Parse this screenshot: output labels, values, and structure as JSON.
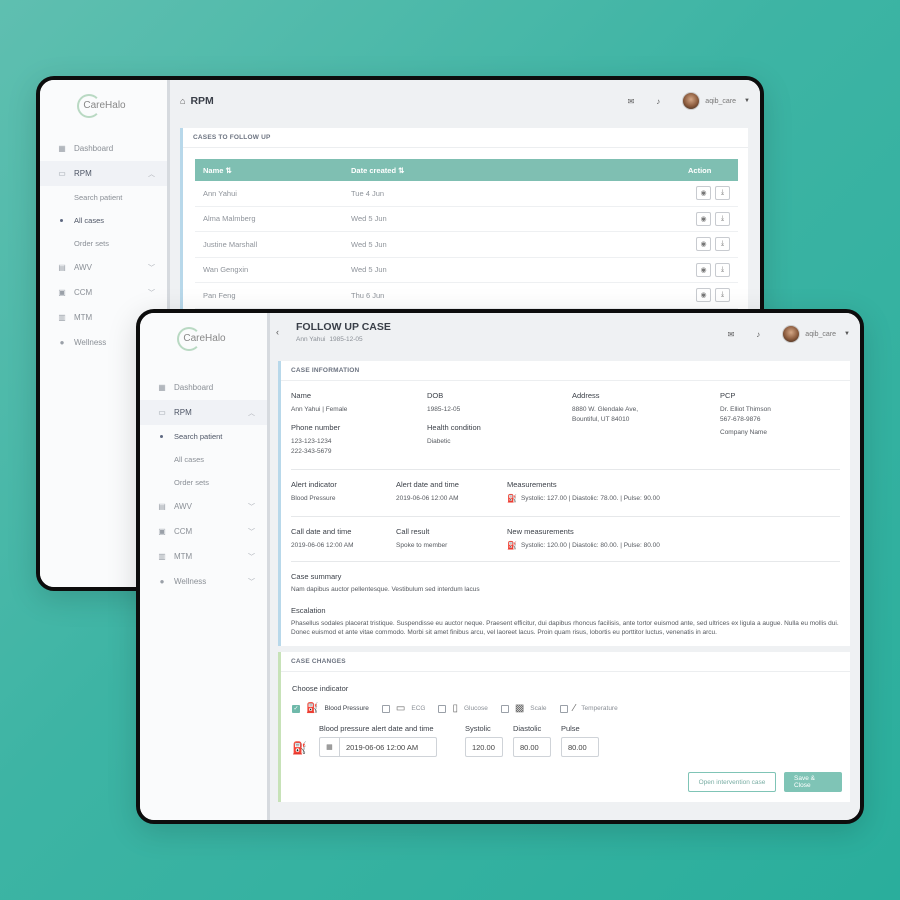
{
  "brand": {
    "logo_text": "CareHalo"
  },
  "user": {
    "name": "aqib_care"
  },
  "sidebar": {
    "dashboard": "Dashboard",
    "rpm": "RPM",
    "rpm_sub": [
      "Search patient",
      "All cases",
      "Order sets"
    ],
    "awv": "AWV",
    "ccm": "CCM",
    "mtm": "MTM",
    "wellness": "Wellness"
  },
  "back_screen": {
    "page_title": "RPM",
    "card_title": "CASES TO FOLLOW UP",
    "columns": {
      "name": "Name",
      "date": "Date created",
      "action": "Action"
    },
    "rows": [
      {
        "name": "Ann Yahui",
        "date": "Tue 4 Jun"
      },
      {
        "name": "Alma Malmberg",
        "date": "Wed 5 Jun"
      },
      {
        "name": "Justine Marshall",
        "date": "Wed 5 Jun"
      },
      {
        "name": "Wan Gengxin",
        "date": "Wed 5 Jun"
      },
      {
        "name": "Pan Feng",
        "date": "Thu 6 Jun"
      }
    ]
  },
  "front_screen": {
    "page_title": "FOLLOW UP CASE",
    "subtitle_name": "Ann Yahui",
    "subtitle_dob": "1985-12-05",
    "case_info": {
      "title": "CASE INFORMATION",
      "name_label": "Name",
      "name_value": "Ann Yahui | Female",
      "dob_label": "DOB",
      "dob_value": "1985-12-05",
      "address_label": "Address",
      "address_line1": "8880 W. Glendale Ave,",
      "address_line2": "Bountiful, UT 84010",
      "pcp_label": "PCP",
      "pcp_name": "Dr. Elliot Thimson",
      "pcp_phone": "567-678-9876",
      "pcp_company": "Company Name",
      "phone_label": "Phone number",
      "phone1": "123-123-1234",
      "phone2": "222-343-5679",
      "health_label": "Health condition",
      "health_value": "Diabetic",
      "alert_indicator_label": "Alert indicator",
      "alert_indicator_value": "Blood Pressure",
      "alert_date_label": "Alert date and time",
      "alert_date_value": "2019-06-06 12:00 AM",
      "measurements_label": "Measurements",
      "measurements_value": "Systolic: 127.00  |  Diastolic: 78.00.  |  Pulse: 90.00",
      "call_date_label": "Call date and time",
      "call_date_value": "2019-06-06 12:00 AM",
      "call_result_label": "Call result",
      "call_result_value": "Spoke to member",
      "new_meas_label": "New measurements",
      "new_meas_value": "Systolic: 120.00  |  Diastolic: 80.00.  |  Pulse: 80.00",
      "summary_label": "Case summary",
      "summary_value": "Nam dapibus auctor pellentesque. Vestibulum sed interdum lacus",
      "escalation_label": "Escalation",
      "escalation_value": "Phasellus sodales placerat tristique. Suspendisse eu auctor neque. Praesent efficitur, dui dapibus rhoncus facilisis, ante tortor euismod ante, sed ultrices ex ligula a augue. Nulla eu mollis dui. Donec euismod et ante vitae commodo. Morbi sit amet finibus arcu, vel laoreet lacus. Proin quam risus, lobortis eu porttitor luctus, venenatis in arcu."
    },
    "case_changes": {
      "title": "CASE CHANGES",
      "choose_label": "Choose indicator",
      "indicators": [
        "Blood Pressure",
        "ECG",
        "Glucose",
        "Scale",
        "Temperature"
      ],
      "bp_date_label": "Blood pressure alert date and time",
      "bp_date_value": "2019-06-06 12:00 AM",
      "systolic_label": "Systolic",
      "systolic_value": "120.00",
      "diastolic_label": "Diastolic",
      "diastolic_value": "80.00",
      "pulse_label": "Pulse",
      "pulse_value": "80.00",
      "open_btn": "Open intervention case",
      "save_btn": "Save & Close"
    }
  },
  "colors": {
    "accent": "#7fbfb2",
    "background": "#3db4a4"
  }
}
